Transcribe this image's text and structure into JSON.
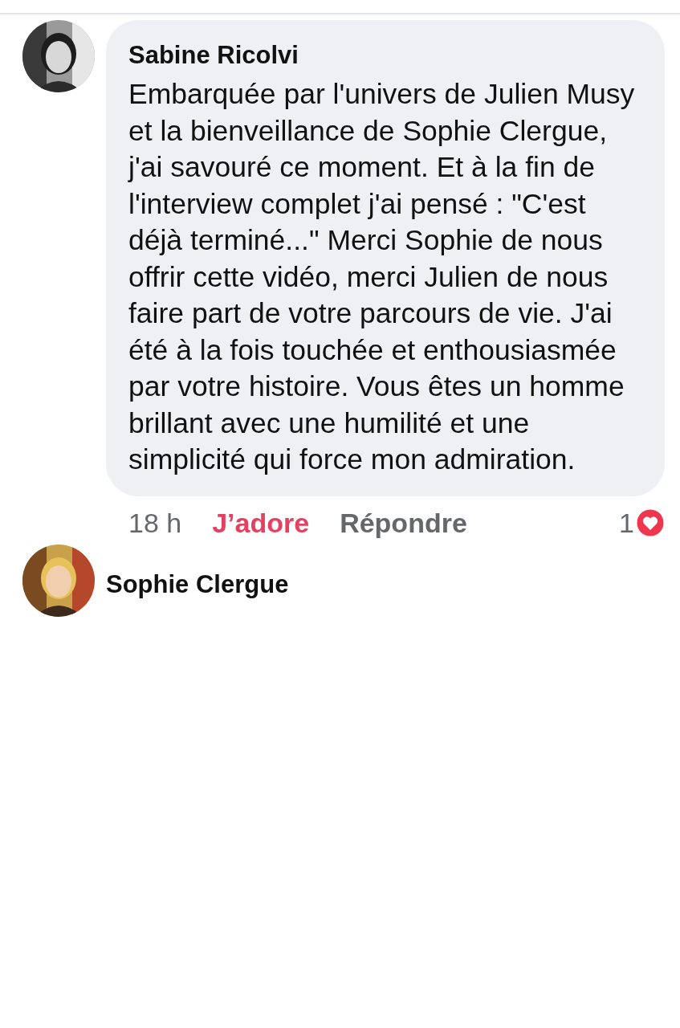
{
  "comments": [
    {
      "author": "Sabine Ricolvi",
      "text": "Embarquée par l'univers de Julien Musy et la bienveillance de Sophie Clergue, j'ai savouré ce moment. Et à la fin de l'interview complet j'ai pensé : \"C'est déjà terminé...\" Merci Sophie de nous offrir cette vidéo, merci Julien de nous faire part de votre parcours de vie. J'ai été à la fois touchée et enthousiasmée par votre histoire. Vous êtes un homme brillant avec une humilité et une simplicité qui force mon admiration.",
      "time": "18 h",
      "like_label": "J’adore",
      "liked": true,
      "reply_label": "Répondre",
      "reaction_count": "1"
    },
    {
      "author": "Sophie Clergue"
    }
  ]
}
